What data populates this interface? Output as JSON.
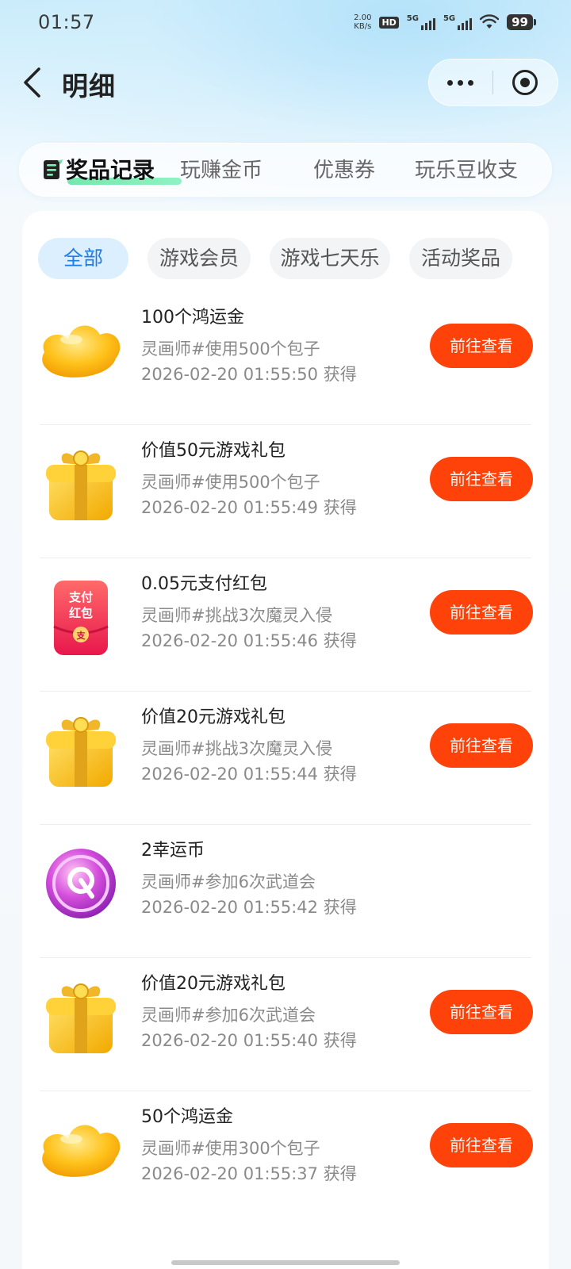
{
  "status_bar": {
    "time": "01:57",
    "net_speed_value": "2.00",
    "net_speed_unit": "KB/s",
    "hd_label": "HD",
    "signal_1_label": "5G",
    "signal_2_label": "5G",
    "battery": "99"
  },
  "header": {
    "title": "明细",
    "back_icon": "chevron-left-icon",
    "more_icon": "more-dots-icon",
    "close_icon": "target-circle-icon"
  },
  "main_tabs": [
    {
      "label": "奖品记录",
      "active": true
    },
    {
      "label": "玩赚金币",
      "active": false
    },
    {
      "label": "优惠券",
      "active": false
    },
    {
      "label": "玩乐豆收支",
      "active": false
    }
  ],
  "filters": [
    {
      "label": "全部",
      "active": true
    },
    {
      "label": "游戏会员",
      "active": false
    },
    {
      "label": "游戏七天乐",
      "active": false
    },
    {
      "label": "活动奖品",
      "active": false
    }
  ],
  "prizes": [
    {
      "name": "100个鸿运金",
      "source": "灵画师#使用500个包子",
      "time": "2026-02-20 01:55:50 获得",
      "icon": "gold-ingot-icon",
      "action": "前往查看"
    },
    {
      "name": "价值50元游戏礼包",
      "source": "灵画师#使用500个包子",
      "time": "2026-02-20 01:55:49 获得",
      "icon": "gift-box-icon",
      "action": "前往查看"
    },
    {
      "name": "0.05元支付红包",
      "source": "灵画师#挑战3次魔灵入侵",
      "time": "2026-02-20 01:55:46 获得",
      "icon": "red-packet-icon",
      "icon_text_line1": "支付",
      "icon_text_line2": "红包",
      "icon_text_seal": "支",
      "action": "前往查看"
    },
    {
      "name": "价值20元游戏礼包",
      "source": "灵画师#挑战3次魔灵入侵",
      "time": "2026-02-20 01:55:44 获得",
      "icon": "gift-box-icon",
      "action": "前往查看"
    },
    {
      "name": "2幸运币",
      "source": "灵画师#参加6次武道会",
      "time": "2026-02-20 01:55:42 获得",
      "icon": "lucky-coin-icon",
      "action": ""
    },
    {
      "name": "价值20元游戏礼包",
      "source": "灵画师#参加6次武道会",
      "time": "2026-02-20 01:55:40 获得",
      "icon": "gift-box-icon",
      "action": "前往查看"
    },
    {
      "name": "50个鸿运金",
      "source": "灵画师#使用300个包子",
      "time": "2026-02-20 01:55:37 获得",
      "icon": "gold-ingot-icon",
      "action": "前往查看"
    }
  ],
  "colors": {
    "accent_orange": "#ff420a",
    "filter_active_text": "#1e7de6",
    "filter_active_bg": "#dcefff",
    "tab_highlight_green": "#5fe3a0"
  }
}
